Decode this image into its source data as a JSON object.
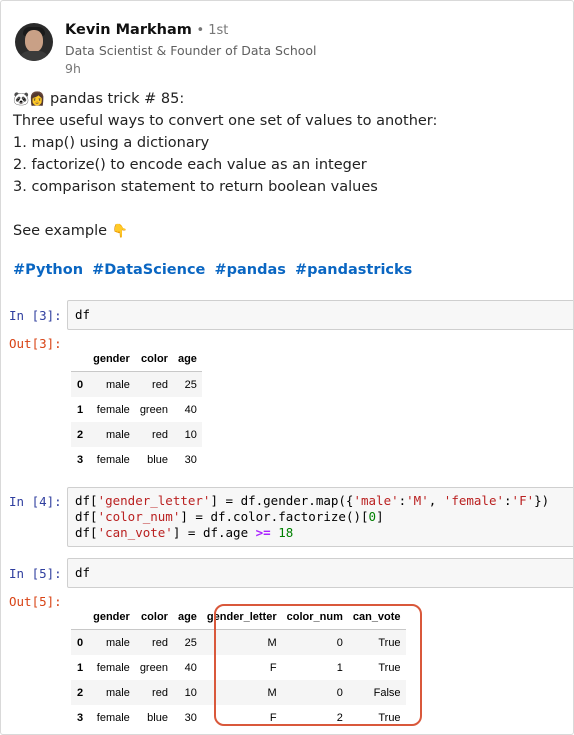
{
  "post": {
    "author": "Kevin Markham",
    "degree": "• 1st",
    "headline": "Data Scientist & Founder of Data School",
    "time": "9h",
    "lines": [
      "pandas trick # 85:",
      "Three useful ways to convert one set of values to another:",
      "1. map() using a dictionary",
      "2. factorize() to encode each value as an integer",
      "3. comparison statement to return boolean values",
      "See example"
    ],
    "hashtags": [
      "#Python",
      "#DataScience",
      "#pandas",
      "#pandastricks"
    ]
  },
  "notebook": {
    "in3": {
      "prompt": "In [3]:",
      "code": "df"
    },
    "out3": {
      "prompt": "Out[3]:"
    },
    "in4": {
      "prompt": "In [4]:",
      "l1": {
        "a": "df[",
        "s1": "'gender_letter'",
        "b": "] = df.gender.map({",
        "s2": "'male'",
        "c": ":",
        "s3": "'M'",
        "d": ", ",
        "s4": "'female'",
        "e": ":",
        "s5": "'F'",
        "f": "})"
      },
      "l2": {
        "a": "df[",
        "s1": "'color_num'",
        "b": "] = df.color.factorize()[",
        "n": "0",
        "c": "]"
      },
      "l3": {
        "a": "df[",
        "s1": "'can_vote'",
        "b": "] = df.age ",
        "op": ">=",
        "sp": " ",
        "n": "18"
      }
    },
    "in5": {
      "prompt": "In [5]:",
      "code": "df"
    },
    "out5": {
      "prompt": "Out[5]:"
    },
    "table1": {
      "columns": [
        "gender",
        "color",
        "age"
      ],
      "rows": [
        {
          "index": "0",
          "gender": "male",
          "color": "red",
          "age": "25"
        },
        {
          "index": "1",
          "gender": "female",
          "color": "green",
          "age": "40"
        },
        {
          "index": "2",
          "gender": "male",
          "color": "red",
          "age": "10"
        },
        {
          "index": "3",
          "gender": "female",
          "color": "blue",
          "age": "30"
        }
      ]
    },
    "table2": {
      "columns": [
        "gender",
        "color",
        "age",
        "gender_letter",
        "color_num",
        "can_vote"
      ],
      "rows": [
        {
          "index": "0",
          "gender": "male",
          "color": "red",
          "age": "25",
          "gender_letter": "M",
          "color_num": "0",
          "can_vote": "True"
        },
        {
          "index": "1",
          "gender": "female",
          "color": "green",
          "age": "40",
          "gender_letter": "F",
          "color_num": "1",
          "can_vote": "True"
        },
        {
          "index": "2",
          "gender": "male",
          "color": "red",
          "age": "10",
          "gender_letter": "M",
          "color_num": "0",
          "can_vote": "False"
        },
        {
          "index": "3",
          "gender": "female",
          "color": "blue",
          "age": "30",
          "gender_letter": "F",
          "color_num": "2",
          "can_vote": "True"
        }
      ]
    }
  },
  "colors": {
    "hashtag": "#0a66c2",
    "in_prompt": "#303f9f",
    "out_prompt": "#d84315",
    "highlight": "#d9583b"
  },
  "icons": {
    "panda": "panda-emoji-icon",
    "person": "person-emoji-icon",
    "point": "point-down-emoji-icon"
  }
}
